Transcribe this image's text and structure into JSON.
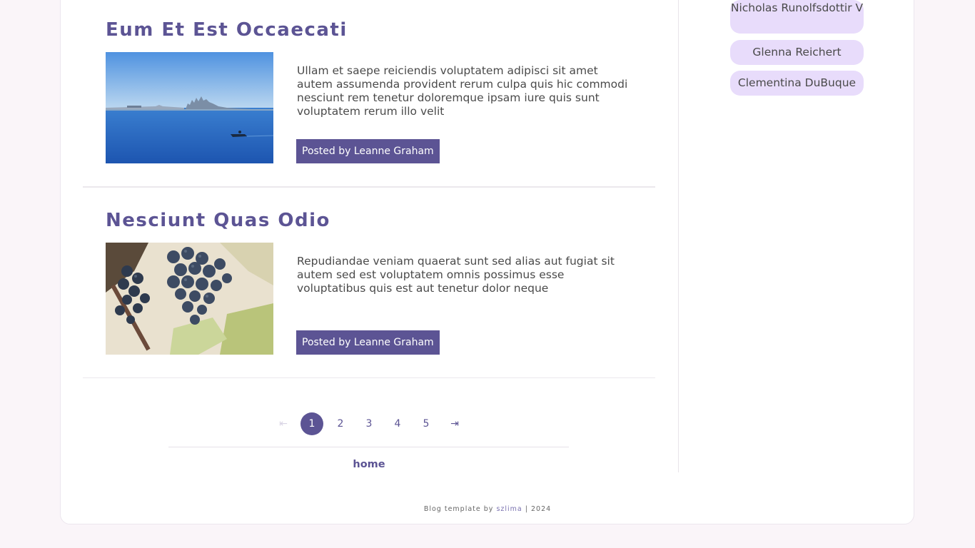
{
  "posts": [
    {
      "title": "Eum Et Est Occaecati",
      "excerpt": "Ullam et saepe reiciendis voluptatem adipisci sit amet autem assumenda provident rerum culpa quis hic commodi nesciunt rem tenetur doloremque ipsam iure quis sunt voluptatem rerum illo velit",
      "author_button": "Posted by Leanne Graham"
    },
    {
      "title": "Nesciunt Quas Odio",
      "excerpt": "Repudiandae veniam quaerat sunt sed alias aut fugiat sit autem sed est voluptatem omnis possimus esse voluptatibus quis est aut tenetur dolor neque",
      "author_button": "Posted by Leanne Graham"
    }
  ],
  "pagination": {
    "first_icon": "⇤",
    "pages": [
      "1",
      "2",
      "3",
      "4",
      "5"
    ],
    "current": "1",
    "last_icon": "⇥"
  },
  "nav": {
    "home_label": "home"
  },
  "footer": {
    "prefix": "Blog template by ",
    "author": "szlima",
    "suffix": " | 2024"
  },
  "sidebar": {
    "authors": [
      "Nicholas Runolfsdottir V",
      "Glenna Reichert",
      "Clementina DuBuque"
    ]
  },
  "colors": {
    "accent": "#5c5494",
    "chip_bg": "#e8dcfb",
    "page_bg": "#faf5f9"
  }
}
